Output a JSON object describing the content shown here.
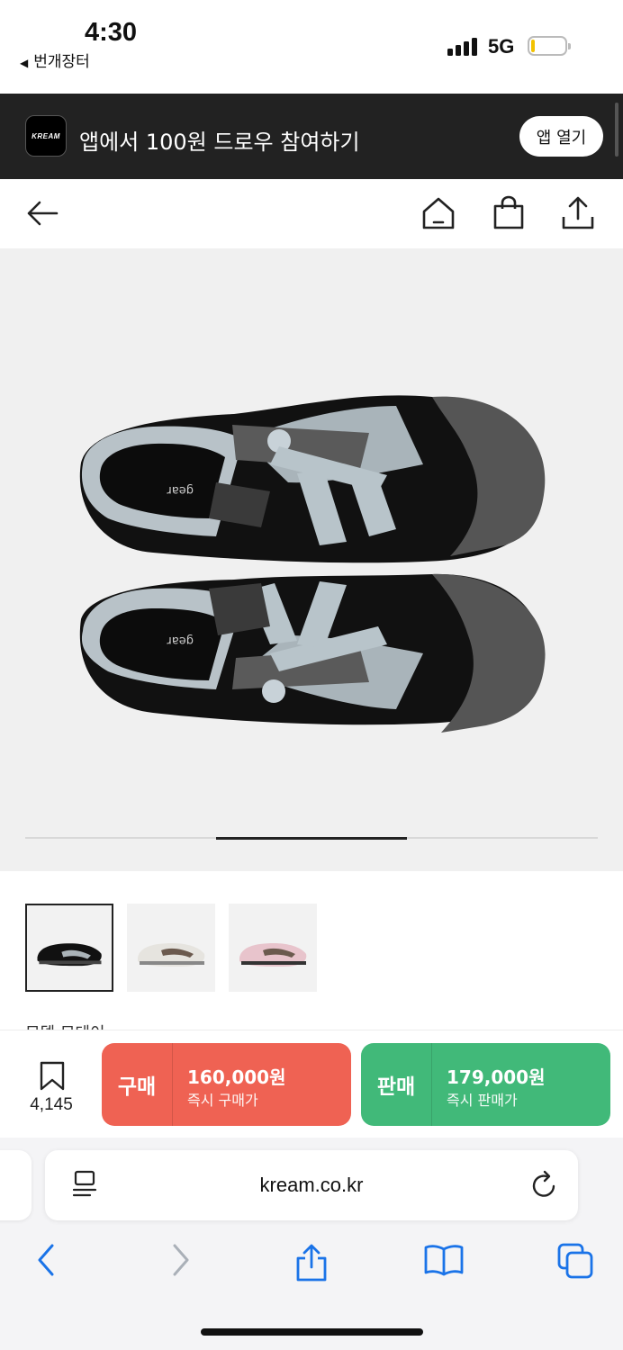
{
  "status_bar": {
    "time": "4:30",
    "back_app": "번개장터",
    "network": "5G"
  },
  "app_banner": {
    "logo_text": "KREAM",
    "message": "앱에서 100원 드로우 참여하기",
    "open_label": "앱 열기"
  },
  "header_nav": {
    "icons": [
      "back-arrow-icon",
      "home-icon",
      "shopping-bag-icon",
      "share-icon"
    ]
  },
  "product": {
    "image_alt": "product-shoes-image",
    "carousel": {
      "current_page": 2,
      "total_pages": 3
    },
    "thumbnails": [
      {
        "name": "black-colorway",
        "selected": true
      },
      {
        "name": "white-colorway",
        "selected": false
      },
      {
        "name": "pink-colorway",
        "selected": false
      }
    ],
    "cut_off_text": "모델 모데이"
  },
  "action_bar": {
    "wish_count": "4,145",
    "buy": {
      "label": "구매",
      "price": "160,000원",
      "sub": "즉시 구매가",
      "color": "#ef6253"
    },
    "sell": {
      "label": "판매",
      "price": "179,000원",
      "sub": "즉시 판매가",
      "color": "#41b979"
    }
  },
  "browser": {
    "url": "kream.co.kr",
    "toolbar": [
      "back-icon",
      "forward-icon",
      "share-icon",
      "bookmarks-icon",
      "tabs-icon"
    ]
  }
}
